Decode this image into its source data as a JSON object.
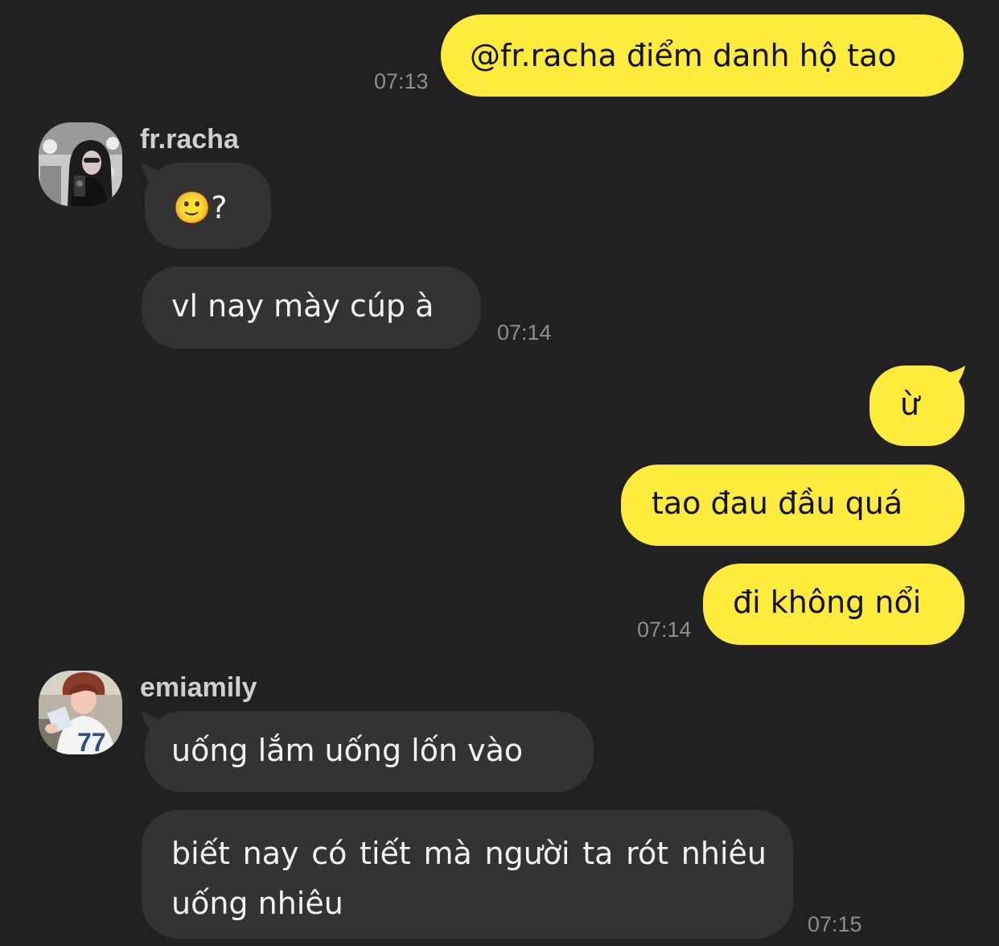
{
  "chat": {
    "messages": [
      {
        "side": "out",
        "text": "@fr.racha điểm danh hộ tao",
        "time": "07:13"
      },
      {
        "side": "in",
        "sender": "fr.racha",
        "text": "🙂?"
      },
      {
        "side": "in",
        "sender": "fr.racha",
        "text": "vl nay mày cúp à",
        "time": "07:14"
      },
      {
        "side": "out",
        "text": "ừ"
      },
      {
        "side": "out",
        "text": "tao đau đầu quá"
      },
      {
        "side": "out",
        "text": "đi không nổi",
        "time": "07:14"
      },
      {
        "side": "in",
        "sender": "emiamily",
        "text": "uống lắm uống lốn vào"
      },
      {
        "side": "in",
        "sender": "emiamily",
        "text": "biết nay có tiết mà người ta rót nhiêu uống nhiêu",
        "time": "07:15"
      }
    ],
    "senders": [
      {
        "name": "fr.racha",
        "avatar_icon": "avatar-photo-girl-mirror-selfie"
      },
      {
        "name": "emiamily",
        "avatar_icon": "avatar-photo-girl-jersey-77"
      }
    ]
  },
  "colors": {
    "background": "#212121",
    "outgoing_bubble": "#ffeb3b",
    "incoming_bubble": "#333333",
    "timestamp": "#8e8e8e",
    "sender_name": "#cfcfcf"
  }
}
